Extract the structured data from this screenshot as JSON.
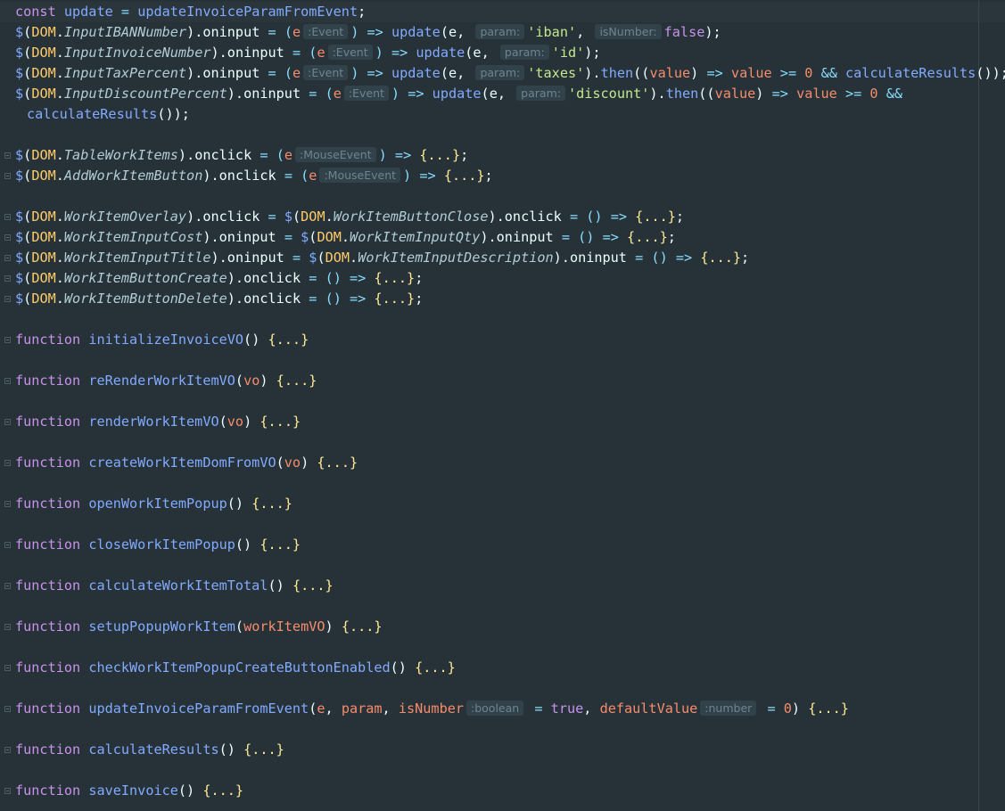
{
  "code": {
    "const_kw": "const",
    "const_name": "update",
    "const_value": "updateInvoiceParamFromEvent",
    "dollar": "$",
    "dom": "DOM",
    "e": "e",
    "update_fn": "update",
    "then_fn": "then",
    "value_param": "value",
    "calc_results": "calculateResults",
    "hint_event": ":Event",
    "hint_mouse_event": ":MouseEvent",
    "hint_param": "param:",
    "hint_is_number": "isNumber:",
    "hint_boolean": ":boolean",
    "hint_number": ":number",
    "prop_iban": "InputIBANNumber",
    "prop_invoice_number": "InputInvoiceNumber",
    "prop_tax": "InputTaxPercent",
    "prop_discount": "InputDiscountPercent",
    "prop_table": "TableWorkItems",
    "prop_add_button": "AddWorkItemButton",
    "prop_overlay": "WorkItemOverlay",
    "prop_button_close": "WorkItemButtonClose",
    "prop_input_cost": "WorkItemInputCost",
    "prop_input_qty": "WorkItemInputQty",
    "prop_input_title": "WorkItemInputTitle",
    "prop_input_desc": "WorkItemInputDescription",
    "prop_button_create": "WorkItemButtonCreate",
    "prop_button_delete": "WorkItemButtonDelete",
    "oninput": "oninput",
    "onclick": "onclick",
    "str_iban": "'iban'",
    "str_id": "'id'",
    "str_taxes": "'taxes'",
    "str_discount": "'discount'",
    "false_kw": "false",
    "true_kw": "true",
    "zero": "0",
    "folded": "{...}",
    "function_kw": "function",
    "fn_initialize": "initializeInvoiceVO",
    "fn_rerender": "reRenderWorkItemVO",
    "fn_render": "renderWorkItemVO",
    "fn_create_dom": "createWorkItemDomFromVO",
    "fn_open_popup": "openWorkItemPopup",
    "fn_close_popup": "closeWorkItemPopup",
    "fn_calc_total": "calculateWorkItemTotal",
    "fn_setup_popup": "setupPopupWorkItem",
    "fn_check_enabled": "checkWorkItemPopupCreateButtonEnabled",
    "fn_update_param": "updateInvoiceParamFromEvent",
    "fn_calc_results": "calculateResults",
    "fn_save_invoice": "saveInvoice",
    "param_vo": "vo",
    "param_work_item_vo": "workItemVO",
    "param_param": "param",
    "param_is_number": "isNumber",
    "param_default_value": "defaultValue"
  },
  "colors": {
    "background": "#263238",
    "keyword": "#c792ea",
    "function": "#82aaff",
    "string": "#c3e88d",
    "number": "#f78c6c",
    "dom_object": "#ffcb6b"
  }
}
